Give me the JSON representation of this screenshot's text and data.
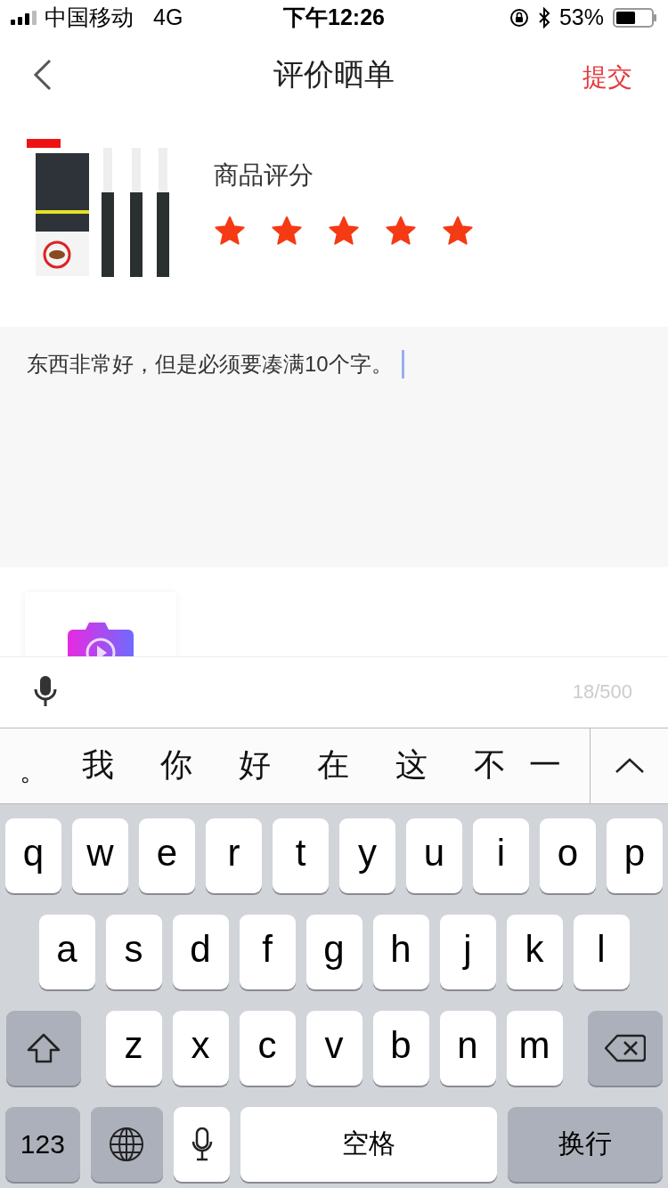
{
  "status_bar": {
    "carrier": "中国移动",
    "network": "4G",
    "time": "下午12:26",
    "battery": "53%"
  },
  "nav": {
    "title": "评价晒单",
    "action": "提交"
  },
  "rating": {
    "label": "商品评分",
    "stars": 5
  },
  "review": {
    "value": "东西非常好，但是必须要凑满10个字。"
  },
  "toolbar": {
    "counter": "18/500"
  },
  "candidates": {
    "items": [
      "。",
      "我",
      "你",
      "好",
      "在",
      "这",
      "不",
      "一"
    ]
  },
  "keyboard": {
    "rows": [
      [
        {
          "kind": "letter",
          "label": "q"
        },
        {
          "kind": "letter",
          "label": "w"
        },
        {
          "kind": "letter",
          "label": "e"
        },
        {
          "kind": "letter",
          "label": "r"
        },
        {
          "kind": "letter",
          "label": "t"
        },
        {
          "kind": "letter",
          "label": "y"
        },
        {
          "kind": "letter",
          "label": "u"
        },
        {
          "kind": "letter",
          "label": "i"
        },
        {
          "kind": "letter",
          "label": "o"
        },
        {
          "kind": "letter",
          "label": "p"
        }
      ],
      [
        {
          "kind": "letter",
          "label": "a"
        },
        {
          "kind": "letter",
          "label": "s"
        },
        {
          "kind": "letter",
          "label": "d"
        },
        {
          "kind": "letter",
          "label": "f"
        },
        {
          "kind": "letter",
          "label": "g"
        },
        {
          "kind": "letter",
          "label": "h"
        },
        {
          "kind": "letter",
          "label": "j"
        },
        {
          "kind": "letter",
          "label": "k"
        },
        {
          "kind": "letter",
          "label": "l"
        }
      ],
      [
        {
          "kind": "shift"
        },
        {
          "kind": "letter",
          "label": "z"
        },
        {
          "kind": "letter",
          "label": "x"
        },
        {
          "kind": "letter",
          "label": "c"
        },
        {
          "kind": "letter",
          "label": "v"
        },
        {
          "kind": "letter",
          "label": "b"
        },
        {
          "kind": "letter",
          "label": "n"
        },
        {
          "kind": "letter",
          "label": "m"
        },
        {
          "kind": "delete"
        }
      ]
    ],
    "bottom_row": {
      "keys": [
        {
          "kind": "numbers",
          "label": "123"
        },
        {
          "kind": "globe"
        },
        {
          "kind": "mic"
        },
        {
          "kind": "space",
          "label": "空格"
        },
        {
          "kind": "return",
          "label": "换行"
        }
      ]
    }
  }
}
